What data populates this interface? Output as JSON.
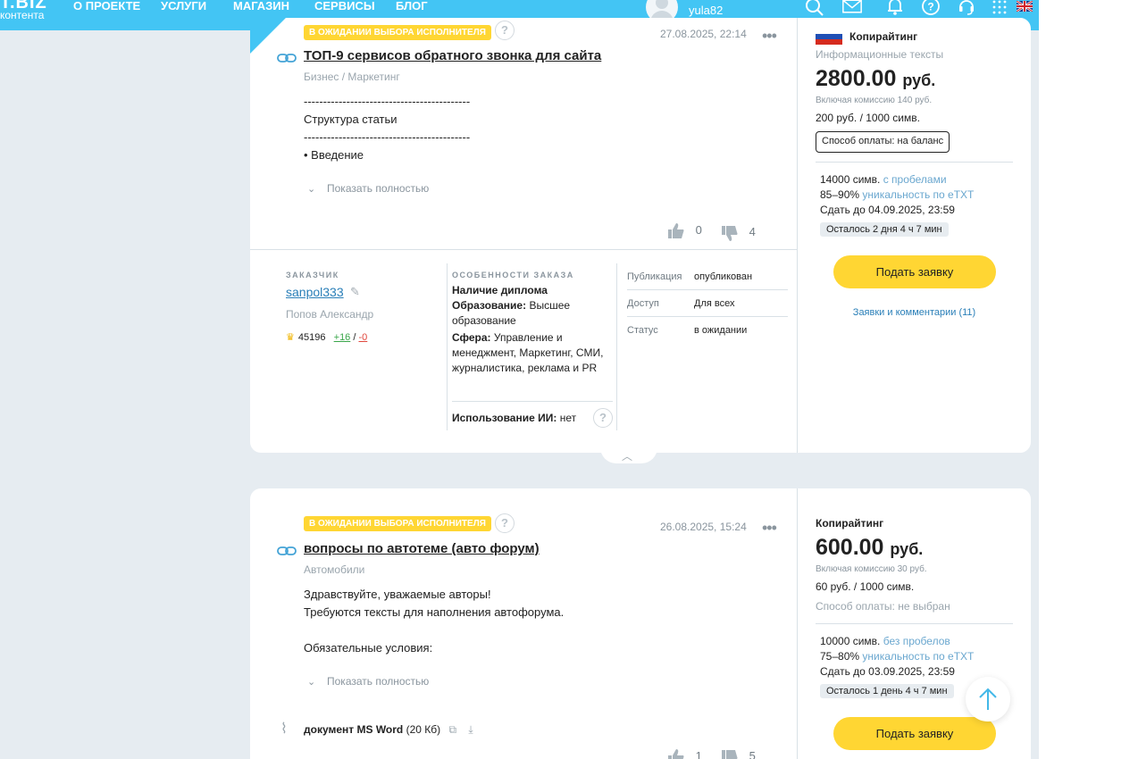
{
  "header": {
    "logo_main": "T.BIZ",
    "logo_sub": "контента",
    "nav": [
      "О ПРОЕКТЕ",
      "УСЛУГИ",
      "МАГАЗИН",
      "СЕРВИСЫ",
      "БЛОГ"
    ],
    "username": "yula82",
    "icons": [
      "search-icon",
      "mail-icon",
      "bell-icon",
      "help-icon",
      "support-headset-icon",
      "apps-grid-icon",
      "uk-flag-icon"
    ],
    "accent": "#43c5f4"
  },
  "orders": [
    {
      "status_badge": "В ОЖИДАНИИ ВЫБОРА ИСПОЛНИТЕЛЯ",
      "help_mark": "?",
      "date": "27.08.2025, 22:14",
      "title": "ТОП-9 сервисов обратного звонка для сайта",
      "category": "Бизнес / Маркетинг",
      "desc_lines": [
        "-------------------------------------------",
        "Структура статьи",
        "-------------------------------------------",
        "• Введение"
      ],
      "show_more": "Показать полностью",
      "likes": "0",
      "dislikes": "4",
      "customer_label": "ЗАКАЗЧИК",
      "customer_login": "sanpol333",
      "customer_name": "Попов Александр",
      "rating": "45196",
      "rating_plus": "+16",
      "rating_sep": "/",
      "rating_minus": "-0",
      "features_label": "ОСОБЕННОСТИ ЗАКАЗА",
      "feature_diploma": "Наличие диплома",
      "feature_edu_k": "Образование:",
      "feature_edu_v": "Высшее образование",
      "feature_sphere_k": "Сфера:",
      "feature_sphere_v": "Управление и менеджмент, Маркетинг, СМИ, журналистика, реклама и PR",
      "feature_ai_k": "Использование ИИ:",
      "feature_ai_v": "нет",
      "meta": [
        {
          "k": "Публикация",
          "v": "опубликован"
        },
        {
          "k": "Доступ",
          "v": "Для всех"
        },
        {
          "k": "Статус",
          "v": "в ожидании"
        }
      ],
      "type": "Копирайтинг",
      "subtype": "Информационные тексты",
      "price": "2800.00",
      "currency": "руб.",
      "commission": "Включая комиссию 140 руб.",
      "rate": "200 руб. / 1000 симв.",
      "payment": "Способ оплаты: на баланс",
      "chars": "14000 симв.",
      "chars_note": "с пробелами",
      "uniq": "85–90%",
      "uniq_note": "уникальность по eTXT",
      "deadline": "Сдать до 04.09.2025, 23:59",
      "left": "Осталось 2 дня 4 ч 7 мин",
      "apply": "Подать заявку",
      "comments": "Заявки и комментарии (11)"
    },
    {
      "status_badge": "В ОЖИДАНИИ ВЫБОРА ИСПОЛНИТЕЛЯ",
      "help_mark": "?",
      "date": "26.08.2025, 15:24",
      "title": "вопросы по автотеме (авто форум)",
      "category": "Автомобили",
      "desc_lines": [
        "Здравствуйте, уважаемые авторы!",
        "Требуются тексты для наполнения автофорума.",
        "",
        "Обязательные условия:"
      ],
      "show_more": "Показать полностью",
      "attachment_name": "документ MS Word",
      "attachment_size": "(20 Кб)",
      "likes": "1",
      "dislikes": "5",
      "type": "Копирайтинг",
      "price": "600.00",
      "currency": "руб.",
      "commission": "Включая комиссию 30 руб.",
      "rate": "60 руб. / 1000 симв.",
      "payment": "Способ оплаты: не выбран",
      "chars": "10000 симв.",
      "chars_note": "без пробелов",
      "uniq": "75–80%",
      "uniq_note": "уникальность по eTXT",
      "deadline": "Сдать до 03.09.2025, 23:59",
      "left": "Осталось 1 день 4 ч 7 мин",
      "apply": "Подать заявку"
    }
  ]
}
